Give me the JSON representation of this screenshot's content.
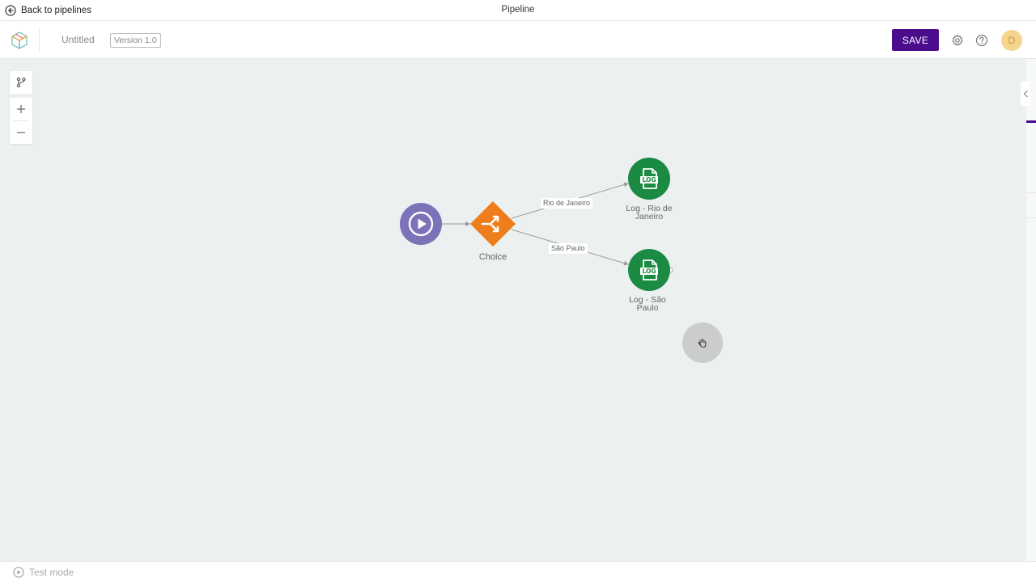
{
  "topbar": {
    "back_label": "Back to pipelines",
    "title": "Pipeline"
  },
  "header": {
    "pipeline_name": "Untitled",
    "version": "Version 1.0",
    "save_label": "SAVE",
    "avatar_initial": "D",
    "icons": [
      "app-logo-icon",
      "gear-icon",
      "help-icon"
    ]
  },
  "canvas": {
    "tools": [
      "branch-icon",
      "zoom-in-icon",
      "zoom-out-icon"
    ],
    "nodes": [
      {
        "id": "trigger",
        "label": "",
        "icon": "play-icon",
        "color": "#7b72b8"
      },
      {
        "id": "choice",
        "label": "Choice",
        "icon": "split-icon",
        "color": "#ee7d1b"
      },
      {
        "id": "log-rio",
        "label_line1": "Log - Rio de",
        "label_line2": "Janeiro",
        "icon": "log-file-icon",
        "color": "#1b8a43"
      },
      {
        "id": "log-sp",
        "label_line1": "Log - São",
        "label_line2": "Paulo",
        "icon": "log-file-icon",
        "color": "#1b8a43"
      }
    ],
    "edges": [
      {
        "from": "trigger",
        "to": "choice",
        "label": ""
      },
      {
        "from": "choice",
        "to": "log-rio",
        "label": "Rio de Janeiro"
      },
      {
        "from": "choice",
        "to": "log-sp",
        "label": "São Paulo"
      }
    ]
  },
  "bottombar": {
    "test_mode_label": "Test mode"
  },
  "colors": {
    "accent": "#4b0d8c",
    "canvas_bg": "#ecf0f0",
    "avatar_bg": "#f6d48e"
  }
}
